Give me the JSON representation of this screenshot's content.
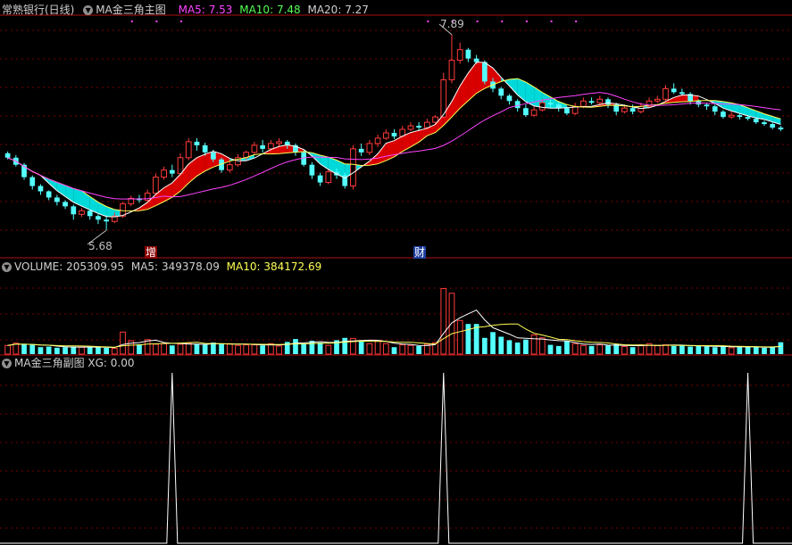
{
  "main_panel": {
    "title": "常熟银行(日线)",
    "indicator_name": "MA金三角主图",
    "ma5_label": "MA5:",
    "ma5_value": "7.53",
    "ma10_label": "MA10:",
    "ma10_value": "7.48",
    "ma20_label": "MA20:",
    "ma20_value": "7.27",
    "high_marker": "7.89",
    "low_marker": "5.68",
    "event_zeng": "增",
    "event_cai": "财"
  },
  "volume_panel": {
    "label": "VOLUME:",
    "value": "205309.95",
    "ma5_label": "MA5:",
    "ma5_value": "349378.09",
    "ma10_label": "MA10:",
    "ma10_value": "384172.69"
  },
  "sub_panel": {
    "indicator_name": "MA金三角副图",
    "xg_label": "XG:",
    "xg_value": "0.00"
  },
  "colors": {
    "up": "#ff3b3b",
    "down": "#54ffff",
    "ma5": "#ffffff",
    "ma10": "#ffff55",
    "ma20": "#ff44ff",
    "fill_bull": "#ff0000",
    "fill_bear": "#00ffff"
  },
  "chart_data": [
    {
      "type": "candlestick",
      "title": "常熟银行(日线)",
      "ylim": [
        5.5,
        8.1
      ],
      "candles": [
        [
          6.55,
          6.5,
          6.57,
          6.48
        ],
        [
          6.5,
          6.42,
          6.53,
          6.4
        ],
        [
          6.42,
          6.28,
          6.44,
          6.25
        ],
        [
          6.28,
          6.18,
          6.3,
          6.14
        ],
        [
          6.18,
          6.12,
          6.2,
          6.08
        ],
        [
          6.12,
          6.05,
          6.13,
          6.02
        ],
        [
          6.05,
          6.0,
          6.08,
          5.96
        ],
        [
          6.0,
          5.95,
          6.02,
          5.92
        ],
        [
          5.95,
          5.86,
          5.97,
          5.8
        ],
        [
          5.86,
          5.9,
          5.93,
          5.83
        ],
        [
          5.9,
          5.84,
          5.92,
          5.8
        ],
        [
          5.84,
          5.8,
          5.86,
          5.75
        ],
        [
          5.8,
          5.78,
          5.85,
          5.68
        ],
        [
          5.78,
          5.84,
          5.88,
          5.76
        ],
        [
          5.84,
          5.98,
          6.0,
          5.82
        ],
        [
          5.98,
          6.04,
          6.07,
          5.95
        ],
        [
          6.04,
          6.02,
          6.08,
          5.99
        ],
        [
          6.02,
          6.1,
          6.14,
          6.0
        ],
        [
          6.1,
          6.28,
          6.32,
          6.08
        ],
        [
          6.28,
          6.36,
          6.4,
          6.25
        ],
        [
          6.36,
          6.32,
          6.42,
          6.28
        ],
        [
          6.32,
          6.5,
          6.55,
          6.3
        ],
        [
          6.5,
          6.68,
          6.72,
          6.47
        ],
        [
          6.68,
          6.64,
          6.72,
          6.58
        ],
        [
          6.64,
          6.56,
          6.67,
          6.52
        ],
        [
          6.56,
          6.48,
          6.59,
          6.45
        ],
        [
          6.48,
          6.36,
          6.5,
          6.33
        ],
        [
          6.36,
          6.42,
          6.46,
          6.33
        ],
        [
          6.42,
          6.5,
          6.54,
          6.4
        ],
        [
          6.5,
          6.56,
          6.58,
          6.47
        ],
        [
          6.56,
          6.64,
          6.68,
          6.54
        ],
        [
          6.64,
          6.6,
          6.7,
          6.56
        ],
        [
          6.6,
          6.66,
          6.7,
          6.57
        ],
        [
          6.66,
          6.68,
          6.72,
          6.62
        ],
        [
          6.68,
          6.64,
          6.7,
          6.6
        ],
        [
          6.64,
          6.56,
          6.66,
          6.52
        ],
        [
          6.56,
          6.42,
          6.58,
          6.4
        ],
        [
          6.42,
          6.3,
          6.45,
          6.26
        ],
        [
          6.3,
          6.22,
          6.33,
          6.18
        ],
        [
          6.22,
          6.34,
          6.38,
          6.2
        ],
        [
          6.34,
          6.3,
          6.38,
          6.26
        ],
        [
          6.3,
          6.18,
          6.33,
          6.15
        ],
        [
          6.18,
          6.6,
          6.64,
          6.14
        ],
        [
          6.6,
          6.56,
          6.66,
          6.52
        ],
        [
          6.56,
          6.66,
          6.7,
          6.53
        ],
        [
          6.66,
          6.72,
          6.76,
          6.62
        ],
        [
          6.72,
          6.78,
          6.82,
          6.7
        ],
        [
          6.78,
          6.74,
          6.82,
          6.71
        ],
        [
          6.74,
          6.82,
          6.86,
          6.72
        ],
        [
          6.82,
          6.86,
          6.9,
          6.8
        ],
        [
          6.86,
          6.84,
          6.9,
          6.8
        ],
        [
          6.84,
          6.9,
          6.94,
          6.82
        ],
        [
          6.9,
          6.96,
          6.98,
          6.87
        ],
        [
          6.96,
          7.38,
          7.46,
          6.94
        ],
        [
          7.38,
          7.6,
          7.89,
          7.34
        ],
        [
          7.6,
          7.72,
          7.8,
          7.56
        ],
        [
          7.72,
          7.62,
          7.74,
          7.58
        ],
        [
          7.62,
          7.58,
          7.66,
          7.56
        ],
        [
          7.58,
          7.36,
          7.6,
          7.33
        ],
        [
          7.36,
          7.28,
          7.4,
          7.24
        ],
        [
          7.28,
          7.2,
          7.3,
          7.16
        ],
        [
          7.2,
          7.14,
          7.22,
          7.1
        ],
        [
          7.14,
          7.06,
          7.16,
          7.02
        ],
        [
          7.06,
          6.98,
          7.1,
          6.96
        ],
        [
          6.98,
          7.04,
          7.08,
          6.96
        ],
        [
          7.04,
          7.12,
          7.16,
          7.02
        ],
        [
          7.12,
          7.1,
          7.16,
          7.07
        ],
        [
          7.1,
          7.06,
          7.14,
          7.02
        ],
        [
          7.06,
          7.0,
          7.08,
          6.98
        ],
        [
          7.0,
          7.08,
          7.12,
          6.98
        ],
        [
          7.08,
          7.14,
          7.18,
          7.06
        ],
        [
          7.14,
          7.12,
          7.18,
          7.1
        ],
        [
          7.12,
          7.16,
          7.2,
          7.1
        ],
        [
          7.16,
          7.1,
          7.18,
          7.06
        ],
        [
          7.1,
          7.02,
          7.12,
          6.98
        ],
        [
          7.02,
          7.06,
          7.1,
          7.0
        ],
        [
          7.06,
          7.02,
          7.1,
          6.99
        ],
        [
          7.02,
          7.08,
          7.12,
          7.0
        ],
        [
          7.08,
          7.14,
          7.18,
          7.06
        ],
        [
          7.14,
          7.16,
          7.2,
          7.12
        ],
        [
          7.16,
          7.28,
          7.32,
          7.14
        ],
        [
          7.28,
          7.24,
          7.34,
          7.22
        ],
        [
          7.24,
          7.22,
          7.28,
          7.2
        ],
        [
          7.22,
          7.14,
          7.24,
          7.1
        ],
        [
          7.14,
          7.1,
          7.16,
          7.07
        ],
        [
          7.1,
          7.08,
          7.12,
          7.04
        ],
        [
          7.08,
          7.02,
          7.1,
          6.98
        ],
        [
          7.02,
          6.96,
          7.04,
          6.94
        ],
        [
          6.96,
          6.98,
          7.02,
          6.94
        ],
        [
          6.98,
          6.96,
          7.0,
          6.93
        ],
        [
          6.96,
          6.94,
          6.98,
          6.92
        ],
        [
          6.94,
          6.9,
          6.96,
          6.88
        ],
        [
          6.9,
          6.88,
          6.92,
          6.86
        ],
        [
          6.88,
          6.84,
          6.9,
          6.82
        ],
        [
          6.84,
          6.82,
          6.86,
          6.8
        ]
      ]
    },
    {
      "type": "bar",
      "title": "VOLUME",
      "ylim": [
        0,
        1400000
      ],
      "values": [
        150000,
        190000,
        170000,
        160000,
        120000,
        130000,
        110000,
        120000,
        130000,
        120000,
        125000,
        115000,
        110000,
        100000,
        380000,
        230000,
        170000,
        250000,
        170000,
        180000,
        150000,
        170000,
        190000,
        170000,
        160000,
        200000,
        170000,
        180000,
        150000,
        160000,
        160000,
        150000,
        180000,
        140000,
        210000,
        260000,
        180000,
        230000,
        200000,
        150000,
        240000,
        280000,
        270000,
        230000,
        180000,
        230000,
        180000,
        120000,
        160000,
        150000,
        140000,
        170000,
        200000,
        1130000,
        1050000,
        580000,
        520000,
        520000,
        280000,
        380000,
        300000,
        240000,
        200000,
        250000,
        330000,
        280000,
        160000,
        140000,
        230000,
        180000,
        150000,
        140000,
        160000,
        150000,
        170000,
        130000,
        120000,
        160000,
        180000,
        150000,
        160000,
        140000,
        150000,
        130000,
        140000,
        130000,
        120000,
        140000,
        110000,
        120000,
        130000,
        120000,
        110000,
        120000,
        205000
      ],
      "ups": [
        true,
        true,
        false,
        false,
        false,
        false,
        false,
        false,
        false,
        true,
        false,
        false,
        false,
        true,
        true,
        true,
        false,
        true,
        true,
        true,
        false,
        true,
        true,
        false,
        false,
        false,
        false,
        true,
        true,
        true,
        true,
        false,
        true,
        true,
        false,
        false,
        false,
        false,
        false,
        true,
        false,
        false,
        true,
        false,
        true,
        true,
        true,
        false,
        true,
        true,
        false,
        true,
        true,
        true,
        true,
        true,
        false,
        false,
        false,
        false,
        false,
        false,
        false,
        false,
        true,
        true,
        false,
        false,
        false,
        true,
        true,
        false,
        true,
        false,
        false,
        true,
        false,
        true,
        true,
        true,
        true,
        false,
        false,
        false,
        false,
        false,
        false,
        false,
        true,
        false,
        false,
        false,
        false,
        false,
        false
      ]
    },
    {
      "type": "line",
      "title": "MA金三角副图",
      "ylim": [
        0,
        1
      ],
      "spikes": [
        20,
        53,
        90
      ]
    }
  ]
}
